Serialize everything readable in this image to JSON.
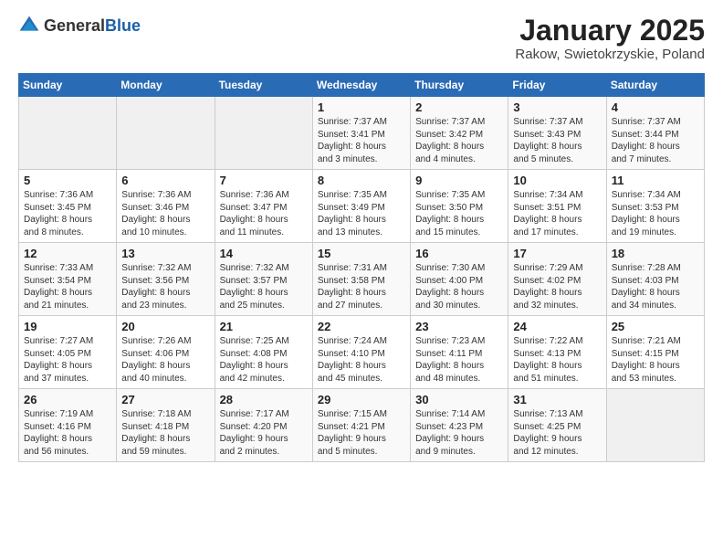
{
  "header": {
    "logo_general": "General",
    "logo_blue": "Blue",
    "title": "January 2025",
    "subtitle": "Rakow, Swietokrzyskie, Poland"
  },
  "weekdays": [
    "Sunday",
    "Monday",
    "Tuesday",
    "Wednesday",
    "Thursday",
    "Friday",
    "Saturday"
  ],
  "weeks": [
    [
      {
        "day": "",
        "content": ""
      },
      {
        "day": "",
        "content": ""
      },
      {
        "day": "",
        "content": ""
      },
      {
        "day": "1",
        "content": "Sunrise: 7:37 AM\nSunset: 3:41 PM\nDaylight: 8 hours\nand 3 minutes."
      },
      {
        "day": "2",
        "content": "Sunrise: 7:37 AM\nSunset: 3:42 PM\nDaylight: 8 hours\nand 4 minutes."
      },
      {
        "day": "3",
        "content": "Sunrise: 7:37 AM\nSunset: 3:43 PM\nDaylight: 8 hours\nand 5 minutes."
      },
      {
        "day": "4",
        "content": "Sunrise: 7:37 AM\nSunset: 3:44 PM\nDaylight: 8 hours\nand 7 minutes."
      }
    ],
    [
      {
        "day": "5",
        "content": "Sunrise: 7:36 AM\nSunset: 3:45 PM\nDaylight: 8 hours\nand 8 minutes."
      },
      {
        "day": "6",
        "content": "Sunrise: 7:36 AM\nSunset: 3:46 PM\nDaylight: 8 hours\nand 10 minutes."
      },
      {
        "day": "7",
        "content": "Sunrise: 7:36 AM\nSunset: 3:47 PM\nDaylight: 8 hours\nand 11 minutes."
      },
      {
        "day": "8",
        "content": "Sunrise: 7:35 AM\nSunset: 3:49 PM\nDaylight: 8 hours\nand 13 minutes."
      },
      {
        "day": "9",
        "content": "Sunrise: 7:35 AM\nSunset: 3:50 PM\nDaylight: 8 hours\nand 15 minutes."
      },
      {
        "day": "10",
        "content": "Sunrise: 7:34 AM\nSunset: 3:51 PM\nDaylight: 8 hours\nand 17 minutes."
      },
      {
        "day": "11",
        "content": "Sunrise: 7:34 AM\nSunset: 3:53 PM\nDaylight: 8 hours\nand 19 minutes."
      }
    ],
    [
      {
        "day": "12",
        "content": "Sunrise: 7:33 AM\nSunset: 3:54 PM\nDaylight: 8 hours\nand 21 minutes."
      },
      {
        "day": "13",
        "content": "Sunrise: 7:32 AM\nSunset: 3:56 PM\nDaylight: 8 hours\nand 23 minutes."
      },
      {
        "day": "14",
        "content": "Sunrise: 7:32 AM\nSunset: 3:57 PM\nDaylight: 8 hours\nand 25 minutes."
      },
      {
        "day": "15",
        "content": "Sunrise: 7:31 AM\nSunset: 3:58 PM\nDaylight: 8 hours\nand 27 minutes."
      },
      {
        "day": "16",
        "content": "Sunrise: 7:30 AM\nSunset: 4:00 PM\nDaylight: 8 hours\nand 30 minutes."
      },
      {
        "day": "17",
        "content": "Sunrise: 7:29 AM\nSunset: 4:02 PM\nDaylight: 8 hours\nand 32 minutes."
      },
      {
        "day": "18",
        "content": "Sunrise: 7:28 AM\nSunset: 4:03 PM\nDaylight: 8 hours\nand 34 minutes."
      }
    ],
    [
      {
        "day": "19",
        "content": "Sunrise: 7:27 AM\nSunset: 4:05 PM\nDaylight: 8 hours\nand 37 minutes."
      },
      {
        "day": "20",
        "content": "Sunrise: 7:26 AM\nSunset: 4:06 PM\nDaylight: 8 hours\nand 40 minutes."
      },
      {
        "day": "21",
        "content": "Sunrise: 7:25 AM\nSunset: 4:08 PM\nDaylight: 8 hours\nand 42 minutes."
      },
      {
        "day": "22",
        "content": "Sunrise: 7:24 AM\nSunset: 4:10 PM\nDaylight: 8 hours\nand 45 minutes."
      },
      {
        "day": "23",
        "content": "Sunrise: 7:23 AM\nSunset: 4:11 PM\nDaylight: 8 hours\nand 48 minutes."
      },
      {
        "day": "24",
        "content": "Sunrise: 7:22 AM\nSunset: 4:13 PM\nDaylight: 8 hours\nand 51 minutes."
      },
      {
        "day": "25",
        "content": "Sunrise: 7:21 AM\nSunset: 4:15 PM\nDaylight: 8 hours\nand 53 minutes."
      }
    ],
    [
      {
        "day": "26",
        "content": "Sunrise: 7:19 AM\nSunset: 4:16 PM\nDaylight: 8 hours\nand 56 minutes."
      },
      {
        "day": "27",
        "content": "Sunrise: 7:18 AM\nSunset: 4:18 PM\nDaylight: 8 hours\nand 59 minutes."
      },
      {
        "day": "28",
        "content": "Sunrise: 7:17 AM\nSunset: 4:20 PM\nDaylight: 9 hours\nand 2 minutes."
      },
      {
        "day": "29",
        "content": "Sunrise: 7:15 AM\nSunset: 4:21 PM\nDaylight: 9 hours\nand 5 minutes."
      },
      {
        "day": "30",
        "content": "Sunrise: 7:14 AM\nSunset: 4:23 PM\nDaylight: 9 hours\nand 9 minutes."
      },
      {
        "day": "31",
        "content": "Sunrise: 7:13 AM\nSunset: 4:25 PM\nDaylight: 9 hours\nand 12 minutes."
      },
      {
        "day": "",
        "content": ""
      }
    ]
  ]
}
